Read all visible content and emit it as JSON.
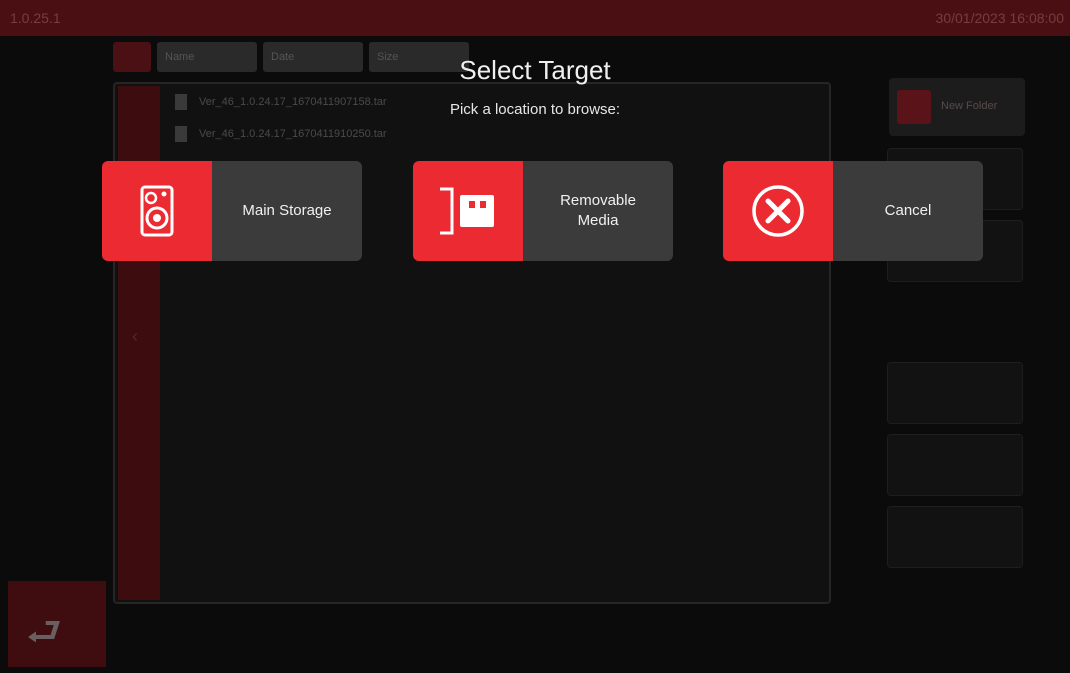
{
  "status_bar": {
    "version": "1.0.25.1",
    "datetime": "30/01/2023 16:08:00"
  },
  "background": {
    "tabs": [
      "Name",
      "Date",
      "Size"
    ],
    "files": [
      "Ver_46_1.0.24.17_1670411907158.tar",
      "Ver_46_1.0.24.17_1670411910250.tar"
    ],
    "new_folder_label": "New Folder"
  },
  "dialog": {
    "title": "Select Target",
    "subtitle": "Pick a location to browse:",
    "options": [
      {
        "label": "Main Storage",
        "icon": "speaker-storage-icon"
      },
      {
        "label": "Removable\nMedia",
        "icon": "usb-media-icon"
      },
      {
        "label": "Cancel",
        "icon": "cancel-x-icon"
      }
    ]
  },
  "colors": {
    "accent": "#ec2a32",
    "button_bg": "#3b3b3b",
    "background": "#0b0b0b",
    "topbar": "#4a0f12"
  }
}
